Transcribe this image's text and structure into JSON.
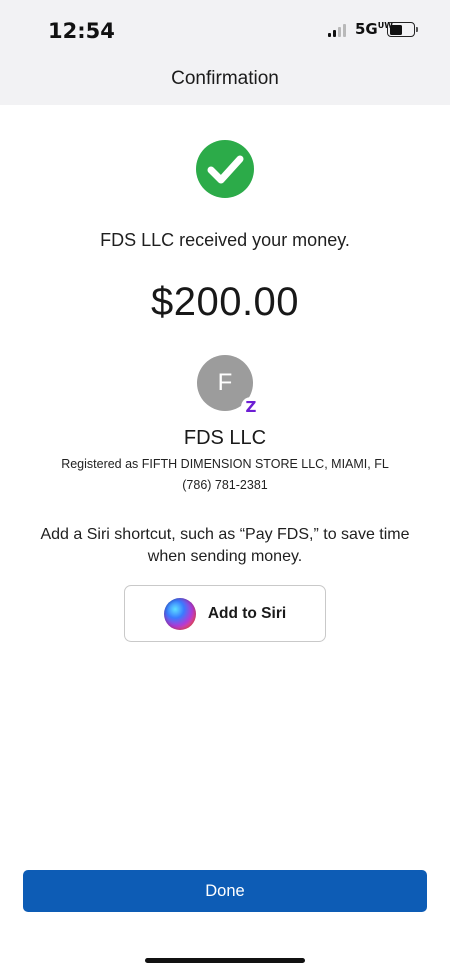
{
  "status_bar": {
    "time": "12:54",
    "network": "5G",
    "network_suffix": "UW",
    "signal_bars_active": 2,
    "battery_level": 0.55
  },
  "header": {
    "title": "Confirmation"
  },
  "confirmation": {
    "status_icon": "check-circle-icon",
    "status_color": "#2cab49",
    "message": "FDS LLC received your money.",
    "amount": "$200.00"
  },
  "recipient": {
    "avatar_initial": "F",
    "badge_icon": "zelle-icon",
    "badge_glyph": "Z",
    "badge_color": "#6d1ed4",
    "name": "FDS LLC",
    "registered": "Registered as FIFTH DIMENSION STORE LLC, MIAMI, FL",
    "phone": "(786) 781-2381"
  },
  "siri": {
    "prompt": "Add a Siri shortcut, such as “Pay FDS,” to save time when sending money.",
    "button_label": "Add to Siri",
    "icon": "siri-icon"
  },
  "footer": {
    "done_label": "Done",
    "accent": "#0d5cb5"
  }
}
